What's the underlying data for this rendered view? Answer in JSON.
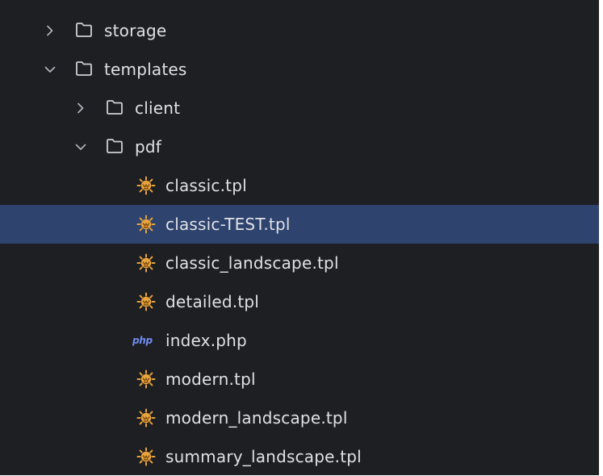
{
  "tree": {
    "storage": {
      "label": "storage",
      "icon": "folder-icon",
      "state": "collapsed"
    },
    "templates": {
      "label": "templates",
      "icon": "folder-icon",
      "state": "expanded"
    },
    "client": {
      "label": "client",
      "icon": "folder-icon",
      "state": "collapsed"
    },
    "pdf": {
      "label": "pdf",
      "icon": "folder-icon",
      "state": "expanded"
    },
    "files": [
      {
        "label": "classic.tpl",
        "icon": "smarty-template-icon"
      },
      {
        "label": "classic-TEST.tpl",
        "icon": "smarty-template-icon",
        "selected": true
      },
      {
        "label": "classic_landscape.tpl",
        "icon": "smarty-template-icon"
      },
      {
        "label": "detailed.tpl",
        "icon": "smarty-template-icon"
      },
      {
        "label": "index.php",
        "icon": "php-file-icon",
        "icon_text": "php"
      },
      {
        "label": "modern.tpl",
        "icon": "smarty-template-icon"
      },
      {
        "label": "modern_landscape.tpl",
        "icon": "smarty-template-icon"
      },
      {
        "label": "summary_landscape.tpl",
        "icon": "smarty-template-icon"
      }
    ]
  },
  "colors": {
    "background": "#1e1f22",
    "text": "#dfe1e5",
    "selection": "#2e436e",
    "template_icon": "#e8a33d",
    "php_icon": "#6f8cf0"
  }
}
